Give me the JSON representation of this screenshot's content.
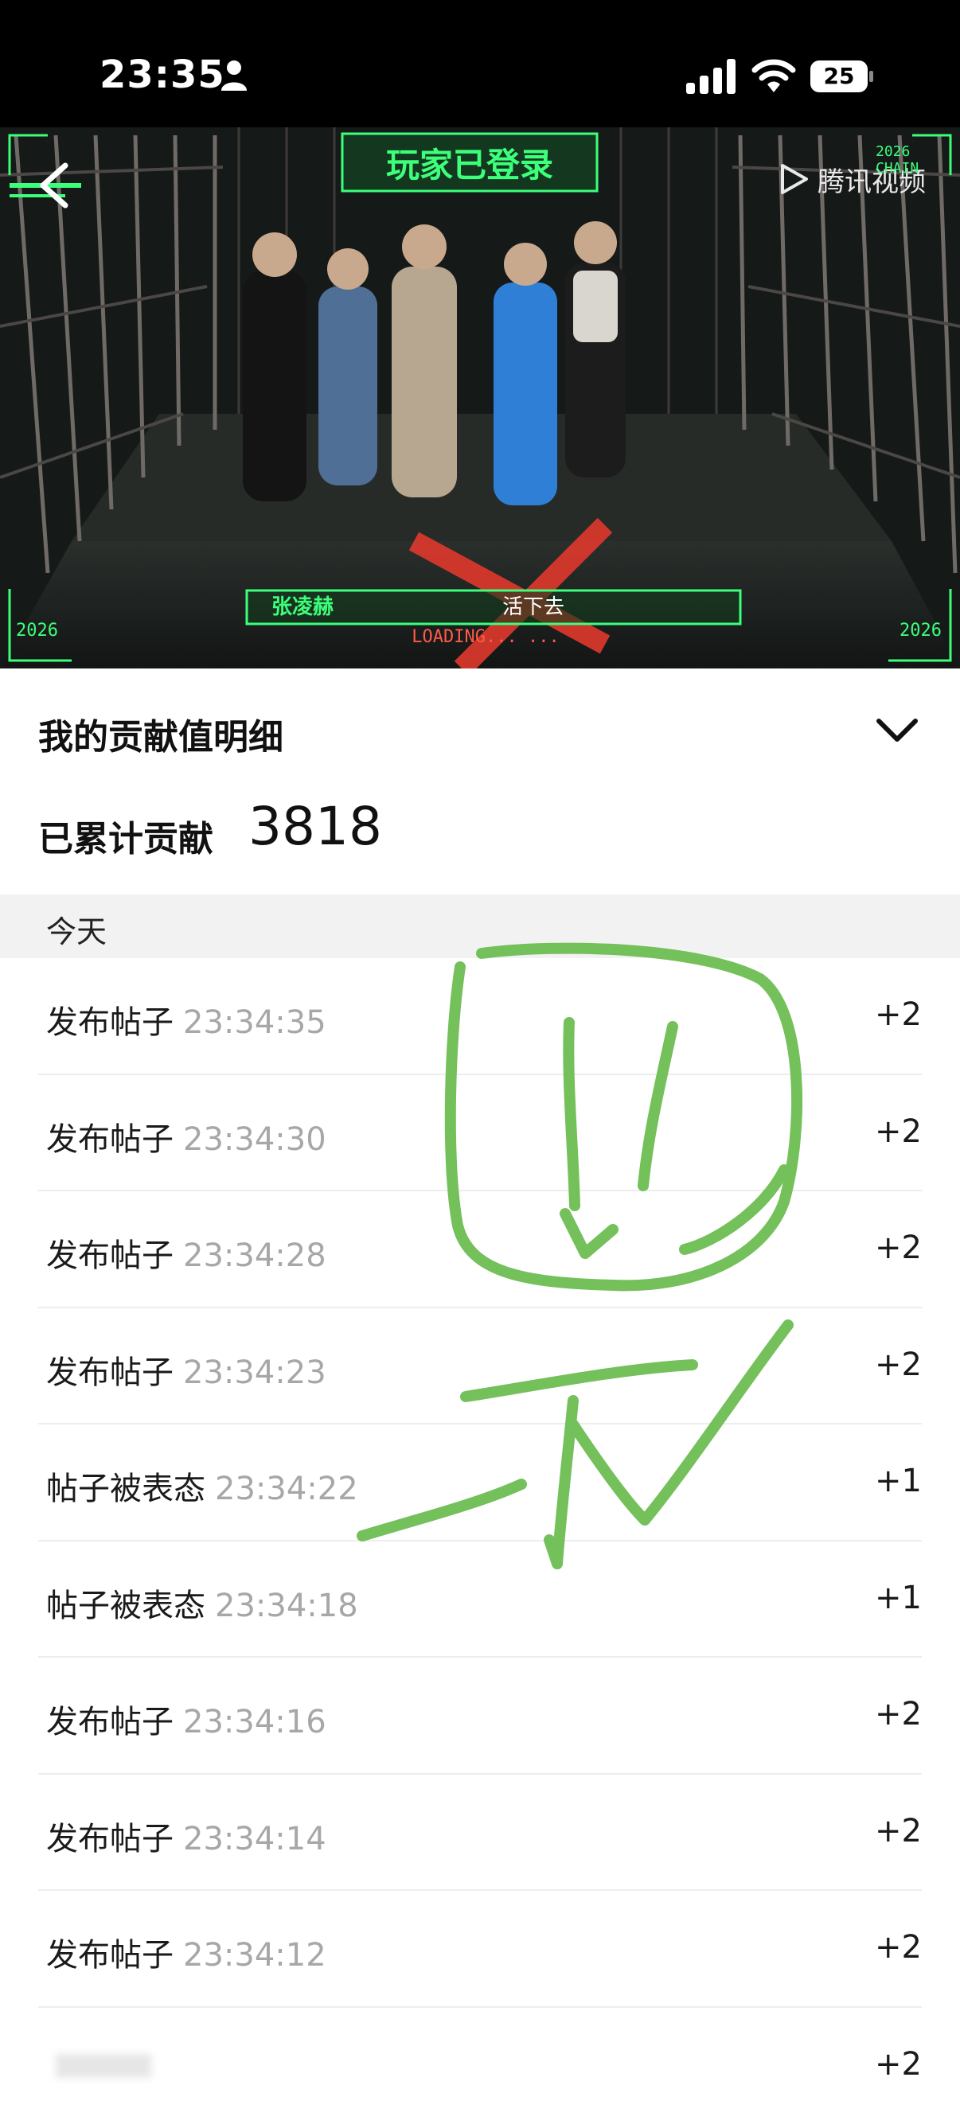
{
  "status_bar": {
    "time": "23:35",
    "battery": "25"
  },
  "video": {
    "banner_text": "玩家已登录",
    "platform_logo": "腾讯视频",
    "caption_name": "张凌赫",
    "caption_text": "活下去",
    "loading_text": "LOADING... ...",
    "year_left": "2026",
    "year_right": "2026",
    "corner_tag": "2026 CHAIN"
  },
  "contribution": {
    "section_title": "我的贡献值明细",
    "total_label": "已累计贡献",
    "total_value": "3818",
    "day_label": "今天"
  },
  "records": [
    {
      "type": "发布帖子",
      "time": "23:34:35",
      "points": "+2"
    },
    {
      "type": "发布帖子",
      "time": "23:34:30",
      "points": "+2"
    },
    {
      "type": "发布帖子",
      "time": "23:34:28",
      "points": "+2"
    },
    {
      "type": "发布帖子",
      "time": "23:34:23",
      "points": "+2"
    },
    {
      "type": "帖子被表态",
      "time": "23:34:22",
      "points": "+1"
    },
    {
      "type": "帖子被表态",
      "time": "23:34:18",
      "points": "+1"
    },
    {
      "type": "发布帖子",
      "time": "23:34:16",
      "points": "+2"
    },
    {
      "type": "发布帖子",
      "time": "23:34:14",
      "points": "+2"
    },
    {
      "type": "发布帖子",
      "time": "23:34:12",
      "points": "+2"
    },
    {
      "type": "",
      "time": "",
      "points": "+2"
    }
  ],
  "colors": {
    "accent_green": "#3cff7a",
    "scribble_green": "#74c05a",
    "muted_text": "#a7a7a7"
  },
  "icons": {
    "back": "chevron-left-icon",
    "collapse": "chevron-down-icon",
    "platform": "play-logo-icon",
    "status": [
      "person-icon",
      "signal-icon",
      "wifi-icon",
      "battery-icon"
    ]
  }
}
